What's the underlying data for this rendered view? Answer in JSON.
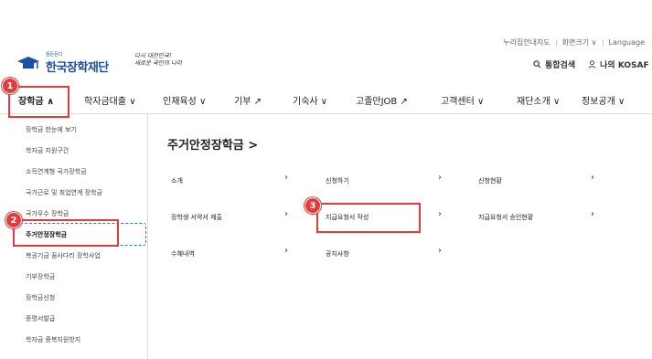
{
  "util": {
    "guide": "누리집안내지도",
    "fontsize": "화면크기",
    "language": "Language"
  },
  "logo": {
    "tag": "꿈든든다",
    "name": "한국장학재단",
    "slogan_line1": "다시 대한민국!",
    "slogan_line2": "새로운 국민의 나라"
  },
  "search": {
    "search_label": "통합검색",
    "my_label": "나의 KOSAF"
  },
  "nav": [
    {
      "label": "장학금",
      "suffix": "∧"
    },
    {
      "label": "학자금대출",
      "suffix": "∨"
    },
    {
      "label": "인재육성",
      "suffix": "∨"
    },
    {
      "label": "기부",
      "suffix": "↗"
    },
    {
      "label": "기숙사",
      "suffix": "∨"
    },
    {
      "label": "고졸만JOB",
      "suffix": "↗"
    },
    {
      "label": "고객센터",
      "suffix": "∨"
    },
    {
      "label": "재단소개",
      "suffix": "∨"
    },
    {
      "label": "정보공개",
      "suffix": "∨"
    }
  ],
  "sidebar": [
    "장학금 한눈에 보기",
    "학자금 지원구간",
    "소득연계형 국가장학금",
    "국가근로 및 취업연계 장학금",
    "국가우수 장학금",
    "주거안정장학금",
    "복권기금 꿈사다리 장학사업",
    "기부장학금",
    "장학금신청",
    "증명서발급",
    "학자금 중복지원방지"
  ],
  "main": {
    "title": "주거안정장학금 >",
    "cells": [
      "소개",
      "신청하기",
      "신청현황",
      "장학생 서약서 제출",
      "지급요청서 작성",
      "지급요청서 승인현황",
      "수혜내역",
      "공지사항"
    ]
  },
  "badges": [
    "1",
    "2",
    "3"
  ],
  "colors": {
    "accent": "#e23b3b",
    "brand": "#1b4fa0",
    "dash": "#3b6fd6"
  }
}
